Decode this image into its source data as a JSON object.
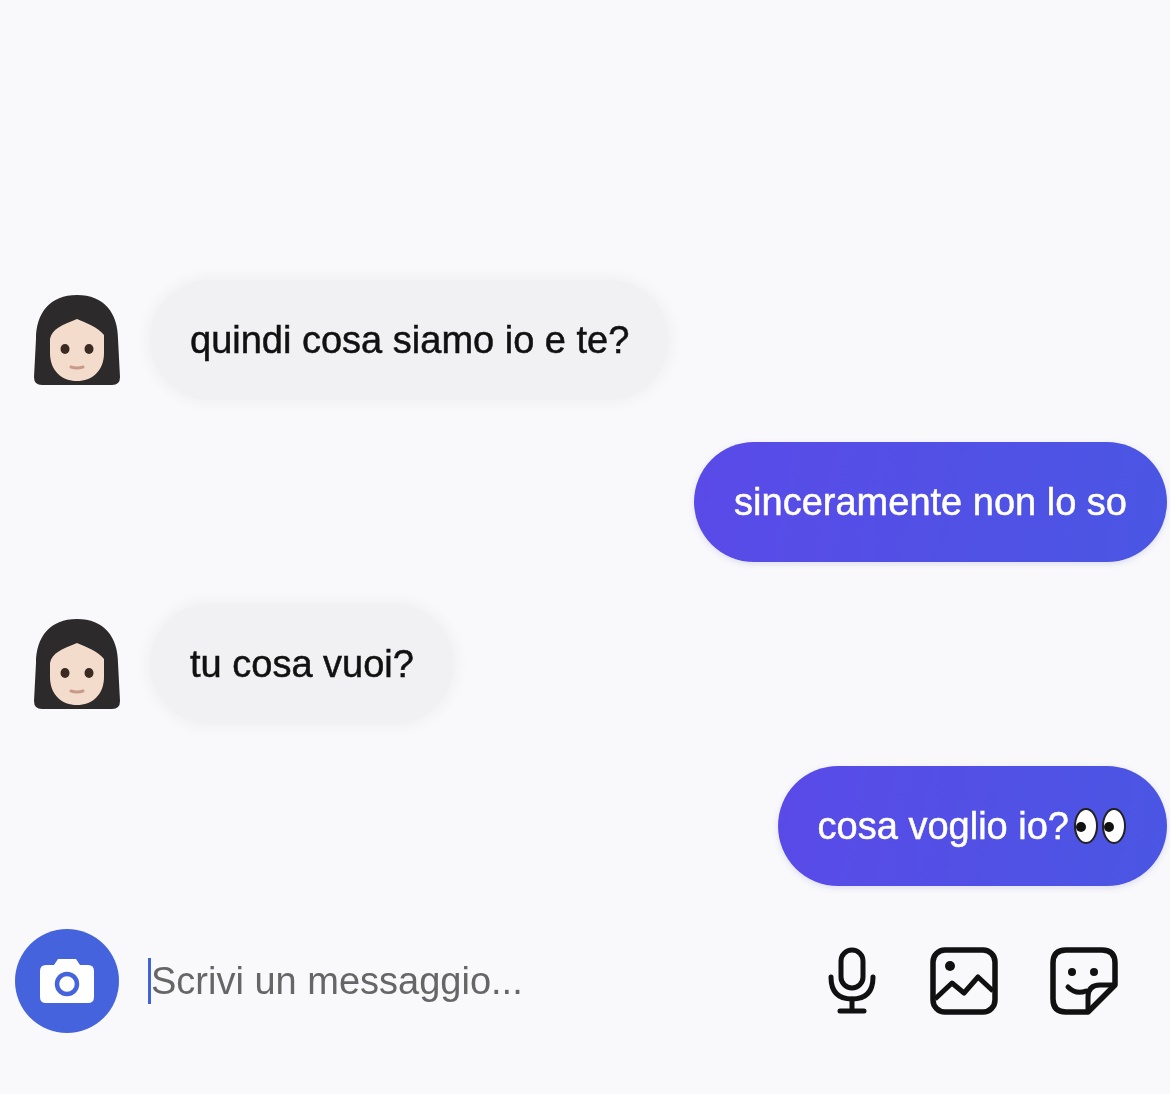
{
  "messages": [
    {
      "kind": "received",
      "text": "quindi cosa siamo io e te?",
      "emoji": false
    },
    {
      "kind": "sent",
      "text": "sinceramente non lo so",
      "emoji": false
    },
    {
      "kind": "received",
      "text": "tu cosa vuoi?",
      "emoji": false
    },
    {
      "kind": "sent",
      "text": "cosa voglio io?",
      "emoji": true
    }
  ],
  "composer": {
    "placeholder": "Scrivi un messaggio...",
    "focused": true
  }
}
